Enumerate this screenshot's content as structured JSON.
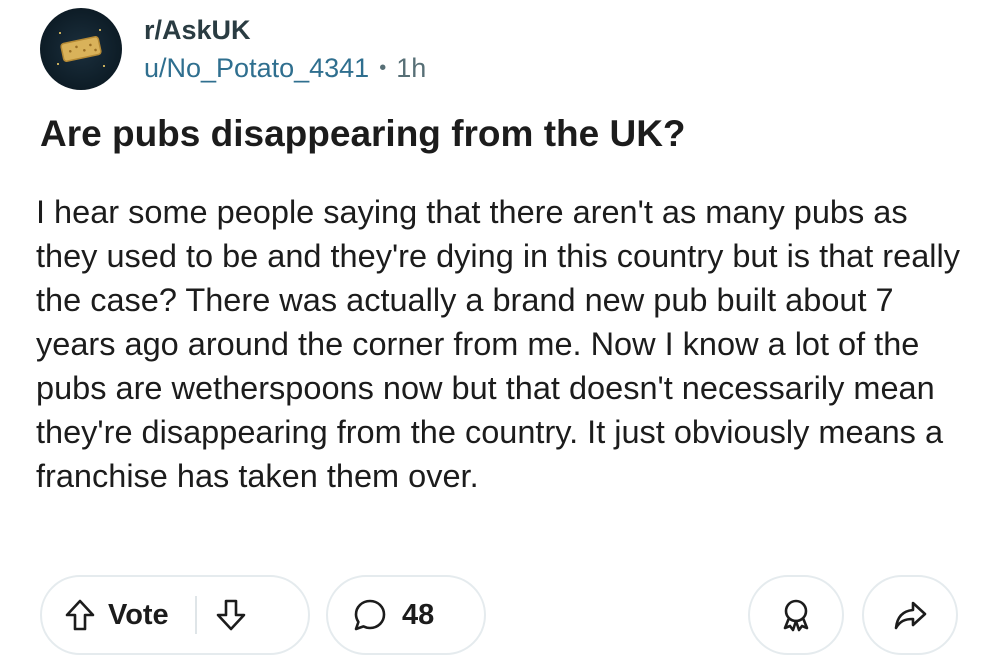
{
  "header": {
    "subreddit": "r/AskUK",
    "username": "u/No_Potato_4341",
    "separator": "•",
    "time": "1h",
    "avatar_icon": "biscuit-avatar-icon"
  },
  "post": {
    "title": "Are pubs disappearing from the UK?",
    "body": "I hear some people saying that there aren't as many pubs as they used to be and they're dying in this country but is that really the case? There was actually a brand new pub built about 7 years ago around the corner from me. Now I know a lot of the pubs are wetherspoons now but that doesn't necessarily mean they're disappearing from the country. It just obviously means a franchise has taken them over."
  },
  "actions": {
    "vote_label": "Vote",
    "comment_count": "48",
    "icons": [
      "upvote-arrow-icon",
      "downvote-arrow-icon",
      "comment-bubble-icon",
      "award-icon",
      "share-arrow-icon"
    ]
  },
  "colors": {
    "subreddit": "#2a3c42",
    "username": "#2f6f8f",
    "muted": "#576f76",
    "text": "#1c1c1c",
    "pill_border": "#e5ebee"
  }
}
